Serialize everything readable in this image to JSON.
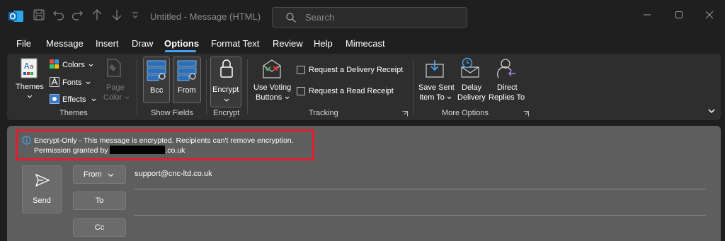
{
  "window": {
    "title": "Untitled  -  Message (HTML)",
    "search_placeholder": "Search",
    "app_icon": "outlook-logo",
    "accent": "#4aa0f0"
  },
  "quick_access": [
    "save-icon",
    "undo-icon",
    "redo-icon",
    "up-arrow-icon",
    "down-arrow-icon",
    "customize-icon"
  ],
  "menu": {
    "tabs": [
      "File",
      "Message",
      "Insert",
      "Draw",
      "Options",
      "Format Text",
      "Review",
      "Help",
      "Mimecast"
    ],
    "active": "Options"
  },
  "ribbon": {
    "themes_group": {
      "label": "Themes",
      "themes": "Themes",
      "colors": "Colors",
      "fonts": "Fonts",
      "effects": "Effects",
      "page_color_1": "Page",
      "page_color_2": "Color"
    },
    "show_fields_group": {
      "label": "Show Fields",
      "bcc": "Bcc",
      "from": "From"
    },
    "encrypt_group": {
      "label": "Encrypt",
      "encrypt": "Encrypt"
    },
    "tracking_group": {
      "label": "Tracking",
      "voting_1": "Use Voting",
      "voting_2": "Buttons",
      "delivery_receipt": "Request a Delivery Receipt",
      "read_receipt": "Request a Read Receipt"
    },
    "more_options_group": {
      "label": "More Options",
      "save_sent_1": "Save Sent",
      "save_sent_2": "Item To",
      "delay_1": "Delay",
      "delay_2": "Delivery",
      "direct_1": "Direct",
      "direct_2": "Replies To"
    }
  },
  "compose": {
    "info_line1": "Encrypt-Only - This message is encrypted. Recipients can't remove encryption.",
    "info_line2_prefix": "Permission granted by ",
    "info_line2_suffix": ".co.uk",
    "highlight_color": "#e0202a",
    "send": "Send",
    "from_label": "From",
    "to_label": "To",
    "cc_label": "Cc",
    "from_value": "support@cnc-ltd.co.uk"
  }
}
